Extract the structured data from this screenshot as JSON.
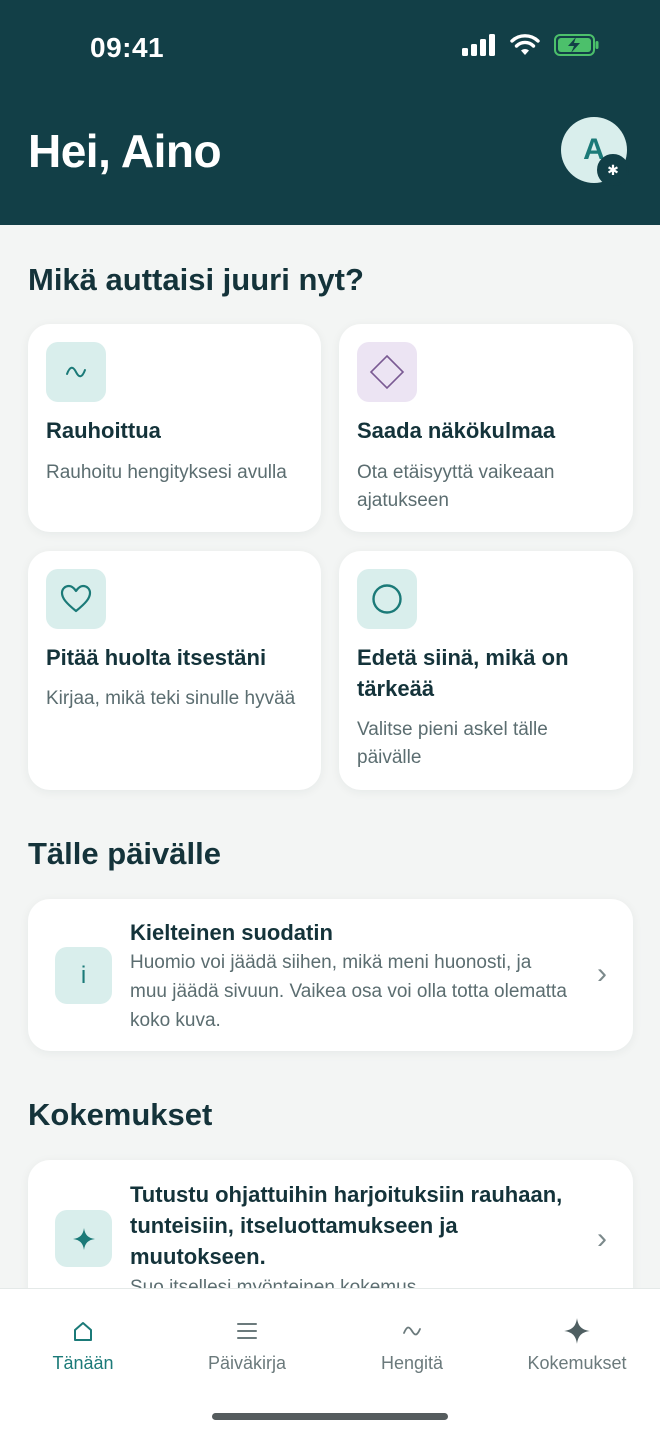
{
  "status": {
    "time": "09:41"
  },
  "header": {
    "greeting": "Hei, Aino",
    "avatar_initial": "A"
  },
  "help": {
    "title": "Mikä auttaisi juuri nyt?",
    "tiles": [
      {
        "title": "Rauhoittua",
        "desc": "Rauhoitu hengityksesi avulla",
        "icon": "wave-icon"
      },
      {
        "title": "Saada näkökulmaa",
        "desc": "Ota etäisyyttä vaikeaan ajatukseen",
        "icon": "diamond-icon"
      },
      {
        "title": "Pitää huolta itsestäni",
        "desc": "Kirjaa, mikä teki sinulle hyvää",
        "icon": "heart-icon"
      },
      {
        "title": "Edetä siinä, mikä on tärkeää",
        "desc": "Valitse pieni askel tälle päivälle",
        "icon": "circle-icon"
      }
    ]
  },
  "today": {
    "title": "Tälle päivälle",
    "card": {
      "icon_glyph": "i",
      "title": "Kielteinen suodatin",
      "desc": "Huomio voi jäädä siihen, mikä meni huonosti, ja muu jäädä sivuun. Vaikea osa voi olla totta olematta koko kuva."
    }
  },
  "experiences": {
    "title": "Kokemukset",
    "card": {
      "title": "Tutustu ohjattuihin harjoituksiin rauhaan, tunteisiin, itseluottamukseen ja muutokseen.",
      "desc": "Suo itsellesi myönteinen kokemus."
    }
  },
  "tabs": [
    {
      "label": "Tänään",
      "icon": "home-icon",
      "active": true
    },
    {
      "label": "Päiväkirja",
      "icon": "list-icon",
      "active": false
    },
    {
      "label": "Hengitä",
      "icon": "wave-icon",
      "active": false
    },
    {
      "label": "Kokemukset",
      "icon": "sparkle-icon",
      "active": false
    }
  ],
  "colors": {
    "header_bg": "#123f47",
    "accent": "#1b7a78",
    "tile_teal": "#d9eeec",
    "tile_lavender": "#ece4f3"
  }
}
